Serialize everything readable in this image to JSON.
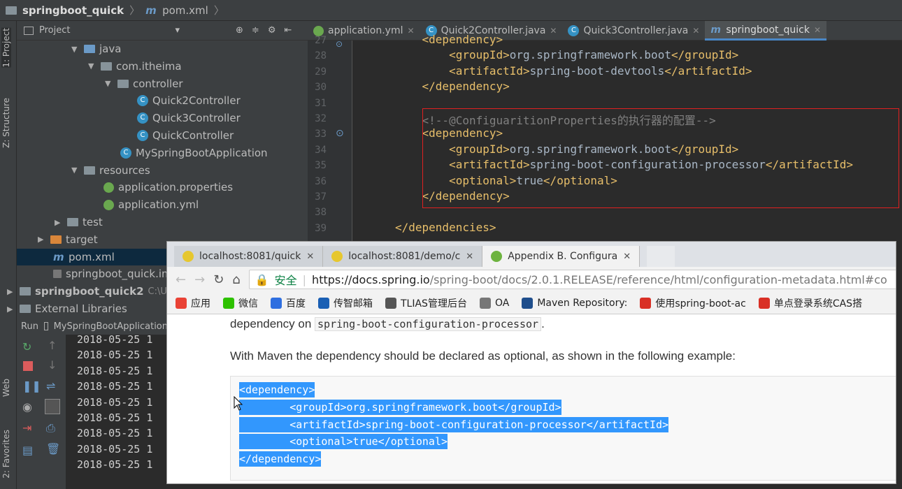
{
  "breadcrumb": {
    "project": "springboot_quick",
    "file": "pom.xml"
  },
  "side_tabs": {
    "project": "1: Project",
    "structure": "Z: Structure",
    "web": "Web",
    "favorites": "2: Favorites"
  },
  "project_panel": {
    "title": "Project",
    "tree": [
      {
        "label": "java",
        "type": "folder-blue",
        "arrow": "▼"
      },
      {
        "label": "com.itheima",
        "type": "folder",
        "arrow": "▼"
      },
      {
        "label": "controller",
        "type": "folder",
        "arrow": "▼"
      },
      {
        "label": "Quick2Controller",
        "type": "class",
        "arrow": ""
      },
      {
        "label": "Quick3Controller",
        "type": "class",
        "arrow": ""
      },
      {
        "label": "QuickController",
        "type": "class",
        "arrow": ""
      },
      {
        "label": "MySpringBootApplication",
        "type": "class",
        "arrow": ""
      },
      {
        "label": "resources",
        "type": "folder",
        "arrow": "▼"
      },
      {
        "label": "application.properties",
        "type": "leaf",
        "arrow": ""
      },
      {
        "label": "application.yml",
        "type": "leaf",
        "arrow": ""
      },
      {
        "label": "test",
        "type": "folder",
        "arrow": "▶"
      },
      {
        "label": "target",
        "type": "folder-orange",
        "arrow": "▶"
      },
      {
        "label": "pom.xml",
        "type": "maven",
        "arrow": ""
      },
      {
        "label": "springboot_quick.iml",
        "type": "file",
        "arrow": ""
      },
      {
        "label": "springboot_quick2",
        "type": "folder",
        "arrow": "▶",
        "suffix": "C:\\U"
      },
      {
        "label": "External Libraries",
        "type": "lib",
        "arrow": "▶"
      }
    ]
  },
  "editor_tabs": [
    {
      "label": "application.yml"
    },
    {
      "label": "Quick2Controller.java"
    },
    {
      "label": "Quick3Controller.java"
    },
    {
      "label": "springboot_quick",
      "active": true
    }
  ],
  "code_lines": [
    {
      "n": "27",
      "text": "    <dependency>"
    },
    {
      "n": "28",
      "text": "        <groupId>org.springframework.boot</groupId>"
    },
    {
      "n": "29",
      "text": "        <artifactId>spring-boot-devtools</artifactId>"
    },
    {
      "n": "30",
      "text": "    </dependency>"
    },
    {
      "n": "31",
      "text": ""
    },
    {
      "n": "32",
      "text": "    <!--@ConfiguaritionProperties的执行器的配置-->"
    },
    {
      "n": "33",
      "text": "    <dependency>"
    },
    {
      "n": "34",
      "text": "        <groupId>org.springframework.boot</groupId>"
    },
    {
      "n": "35",
      "text": "        <artifactId>spring-boot-configuration-processor</artifactId>"
    },
    {
      "n": "36",
      "text": "        <optional>true</optional>"
    },
    {
      "n": "37",
      "text": "    </dependency>"
    },
    {
      "n": "38",
      "text": ""
    },
    {
      "n": "39",
      "text": "</dependencies>"
    }
  ],
  "run_panel": {
    "label": "Run",
    "config": "MySpringBootApplication"
  },
  "console_lines": [
    "2018-05-25 1",
    "2018-05-25 1",
    "2018-05-25 1",
    "2018-05-25 1",
    "2018-05-25 1",
    "2018-05-25 1",
    "2018-05-25 1",
    "2018-05-25 1",
    "2018-05-25 1"
  ],
  "browser": {
    "tabs": [
      {
        "label": "localhost:8081/quick"
      },
      {
        "label": "localhost:8081/demo/c"
      },
      {
        "label": "Appendix B. Configura",
        "active": true
      }
    ],
    "secure_label": "安全",
    "url_host": "https://docs.spring.io",
    "url_path": "/spring-boot/docs/2.0.1.RELEASE/reference/html/configuration-metadata.html#co",
    "bookmarks": [
      {
        "label": "应用",
        "color": "#e94235"
      },
      {
        "label": "微信",
        "color": "#2dc100"
      },
      {
        "label": "百度",
        "color": "#2f6fe0"
      },
      {
        "label": "传智邮箱",
        "color": "#1a5fb4"
      },
      {
        "label": "TLIAS管理后台",
        "color": "#555555"
      },
      {
        "label": "OA",
        "color": "#777777"
      },
      {
        "label": "Maven Repository:",
        "color": "#1f4e8c"
      },
      {
        "label": "使用spring-boot-ac",
        "color": "#d93025"
      },
      {
        "label": "单点登录系统CAS搭",
        "color": "#d93025"
      }
    ],
    "para1_prefix": "dependency on",
    "para1_code": "spring-boot-configuration-processor",
    "para1_suffix": ".",
    "para2": "With Maven the dependency should be declared as optional, as shown in the following example:",
    "code_lines": [
      "<dependency>",
      "        <groupId>org.springframework.boot</groupId>",
      "        <artifactId>spring-boot-configuration-processor</artifactId>",
      "        <optional>true</optional>",
      "</dependency>"
    ]
  }
}
